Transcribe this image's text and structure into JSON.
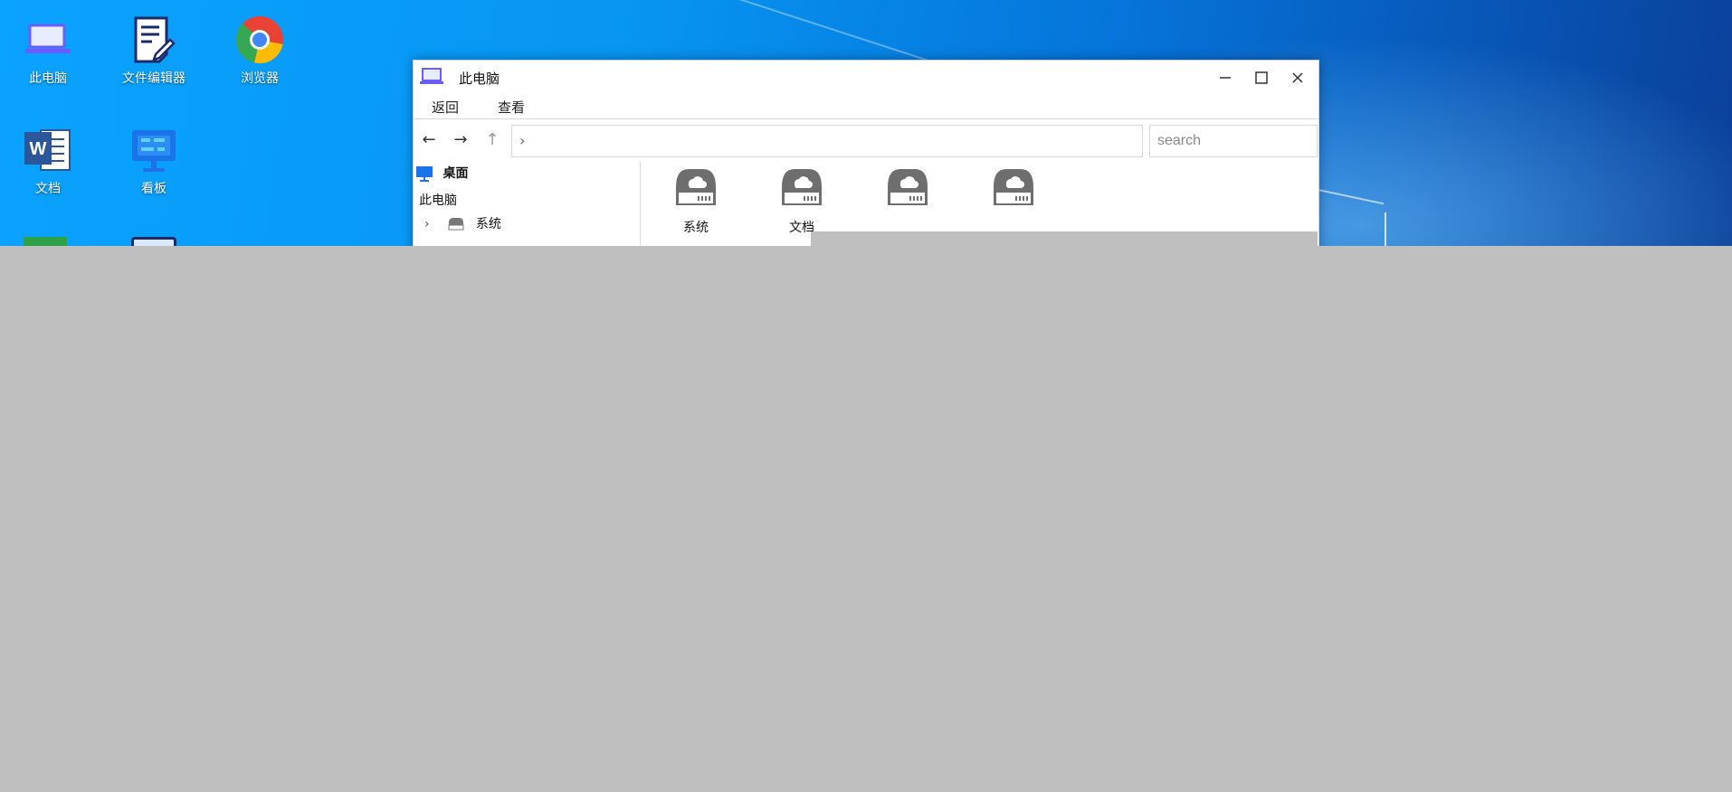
{
  "desktop": {
    "icons": [
      {
        "label": "此电脑",
        "icon": "laptop-icon"
      },
      {
        "label": "文件编辑器",
        "icon": "document-edit-icon"
      },
      {
        "label": "浏览器",
        "icon": "chrome-browser-icon"
      },
      {
        "label": "文档",
        "icon": "word-document-icon"
      },
      {
        "label": "看板",
        "icon": "kanban-board-icon"
      }
    ]
  },
  "window": {
    "title": "此电脑",
    "icon": "laptop-icon",
    "controls": {
      "minimize": "minimize-icon",
      "maximize": "maximize-icon",
      "close": "close-icon"
    },
    "menu": {
      "back_label": "返回",
      "view_label": "查看"
    },
    "nav": {
      "back": "←",
      "forward": "→",
      "up": "↑",
      "address_chevron": "›"
    },
    "search": {
      "placeholder": "search"
    },
    "sidebar": {
      "desktop_label": "桌面",
      "this_pc_label": "此电脑",
      "items": [
        {
          "label": "系统",
          "chevron": "›"
        }
      ]
    },
    "drives": [
      {
        "label": "系统"
      },
      {
        "label": "文档"
      },
      {
        "label": ""
      },
      {
        "label": ""
      }
    ]
  },
  "colors": {
    "desktop_blue": "#0796f2",
    "icon_blue": "#1a73e8",
    "drive_gray": "#6e6e6e"
  }
}
